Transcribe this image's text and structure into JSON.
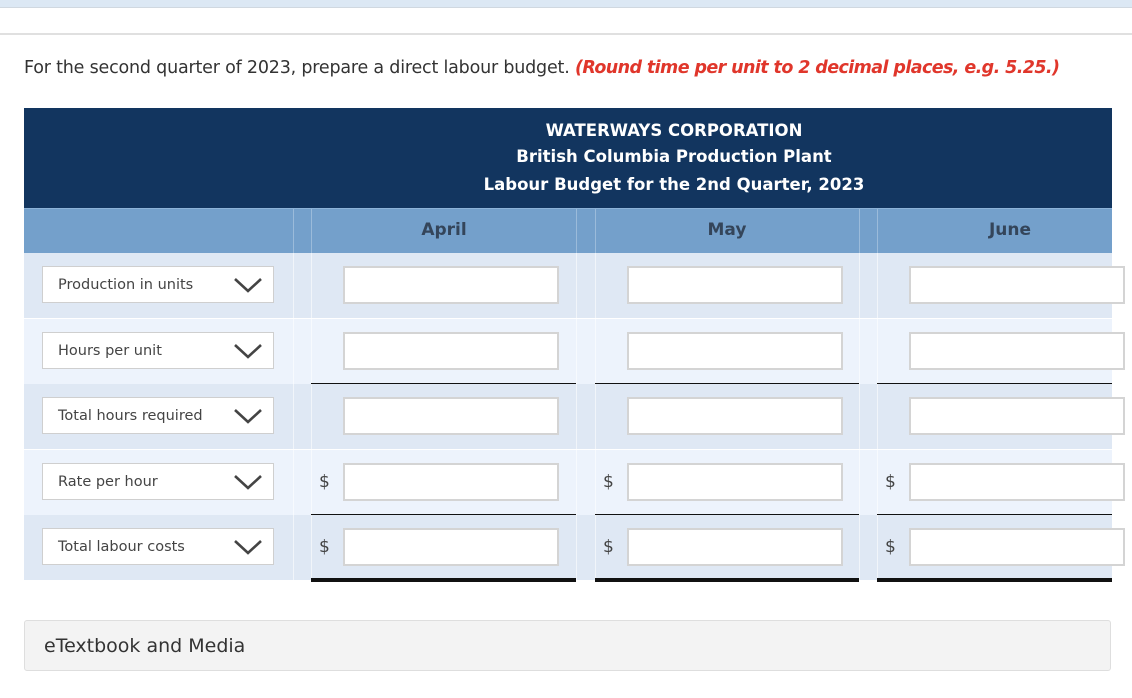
{
  "instructions": {
    "text": "For the second quarter of 2023, prepare a direct labour budget.",
    "hint": "(Round time per unit to 2 decimal places, e.g. 5.25.)",
    "hint_color": "#e0362b"
  },
  "table": {
    "title_lines": [
      "WATERWAYS CORPORATION",
      "British Columbia Production Plant",
      "Labour Budget for the 2nd Quarter, 2023"
    ],
    "header_color": "#12355f",
    "columns": [
      "April",
      "May",
      "June"
    ],
    "rows": [
      {
        "label": "Production in units",
        "show_dollar": false,
        "values": [
          "",
          "",
          ""
        ]
      },
      {
        "label": "Hours per unit",
        "show_dollar": false,
        "values": [
          "",
          "",
          ""
        ]
      },
      {
        "label": "Total hours required",
        "show_dollar": false,
        "values": [
          "",
          "",
          ""
        ]
      },
      {
        "label": "Rate per hour",
        "show_dollar": true,
        "values": [
          "",
          "",
          ""
        ]
      },
      {
        "label": "Total labour costs",
        "show_dollar": true,
        "values": [
          "",
          "",
          ""
        ]
      }
    ],
    "currency_symbol": "$",
    "dropdown_icon": "chevron-down-icon"
  },
  "etextbook": {
    "label": "eTextbook and Media"
  }
}
